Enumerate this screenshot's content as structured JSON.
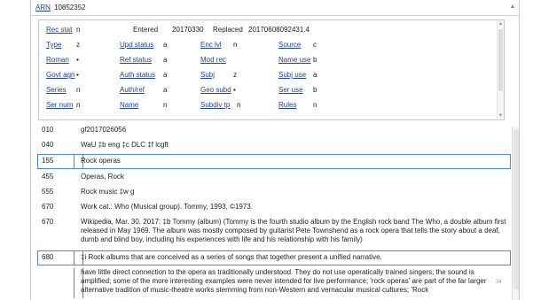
{
  "header": {
    "arn_label": "ARN",
    "arn_number": "10852352"
  },
  "fixed_fields": {
    "rec_stat": {
      "label": "Rec stat",
      "value": "n"
    },
    "entered": {
      "label": "Entered",
      "value": "20170330"
    },
    "replaced": {
      "label": "Replaced",
      "value": "20170608092431.4"
    },
    "type": {
      "label": "Type",
      "value": "z"
    },
    "upd_status": {
      "label": "Upd status",
      "value": "a"
    },
    "enc_lvl": {
      "label": "Enc lvl",
      "value": "n"
    },
    "source": {
      "label": "Source",
      "value": "c"
    },
    "roman": {
      "label": "Roman",
      "value": "▪"
    },
    "ref_status": {
      "label": "Ref status",
      "value": "a"
    },
    "mod_rec": {
      "label": "Mod rec",
      "value": ""
    },
    "name_use": {
      "label": "Name use",
      "value": "b"
    },
    "govt_agn": {
      "label": "Govt agn",
      "value": "▪"
    },
    "auth_status": {
      "label": "Auth status",
      "value": "a"
    },
    "subj": {
      "label": "Subj",
      "value": "z"
    },
    "subj_use": {
      "label": "Subj use",
      "value": "a"
    },
    "series": {
      "label": "Series",
      "value": "n"
    },
    "auth_ref": {
      "label": "Auth/ref",
      "value": "a"
    },
    "geo_subd": {
      "label": "Geo subd",
      "value": "▪"
    },
    "ser_use": {
      "label": "Ser use",
      "value": "b"
    },
    "ser_num": {
      "label": "Ser num",
      "value": "n"
    },
    "name": {
      "label": "Name",
      "value": "n"
    },
    "subdiv_tp": {
      "label": "Subdiv tp",
      "value": "n"
    },
    "rules": {
      "label": "Rules",
      "value": "n"
    }
  },
  "fields": [
    {
      "tag": "010",
      "content": "gf2017026056"
    },
    {
      "tag": "040",
      "content": "WaU ‡b eng ‡c DLC ‡f lcgft"
    },
    {
      "tag": "155",
      "content": "Rock operas"
    },
    {
      "tag": "455",
      "content": "Operas, Rock"
    },
    {
      "tag": "555",
      "content": "Rock music ‡w g"
    },
    {
      "tag": "670",
      "content": "Work cat.: Who (Musical group). Tommy, 1993, ©1973."
    },
    {
      "tag": "670",
      "content": "Wikipedia, Mar. 30, 2017: ‡b Tommy (album) (Tommy is the fourth studio album by the English rock band The Who, a double album first released in May 1969. The album was mostly composed by guitarist Pete Townshend as a rock opera that tells the story about a deaf, dumb and blind boy, including his experiences with life and his relationship with his family)"
    },
    {
      "tag": "680",
      "content": "‡i Rock albums that are conceived as a series of songs that together present a unified narrative."
    },
    {
      "tag": "",
      "content": "have little direct connection to the opera as traditionally understood. They do not use operatically trained singers; the sound is amplified; some of the more interesting examples were never intended for live performance; 'rock operas' are part of the far larger alternative tradition of music-theatre works stemming from non-Western and vernacular musical cultures; 'Rock"
    }
  ],
  "page_number": "34"
}
